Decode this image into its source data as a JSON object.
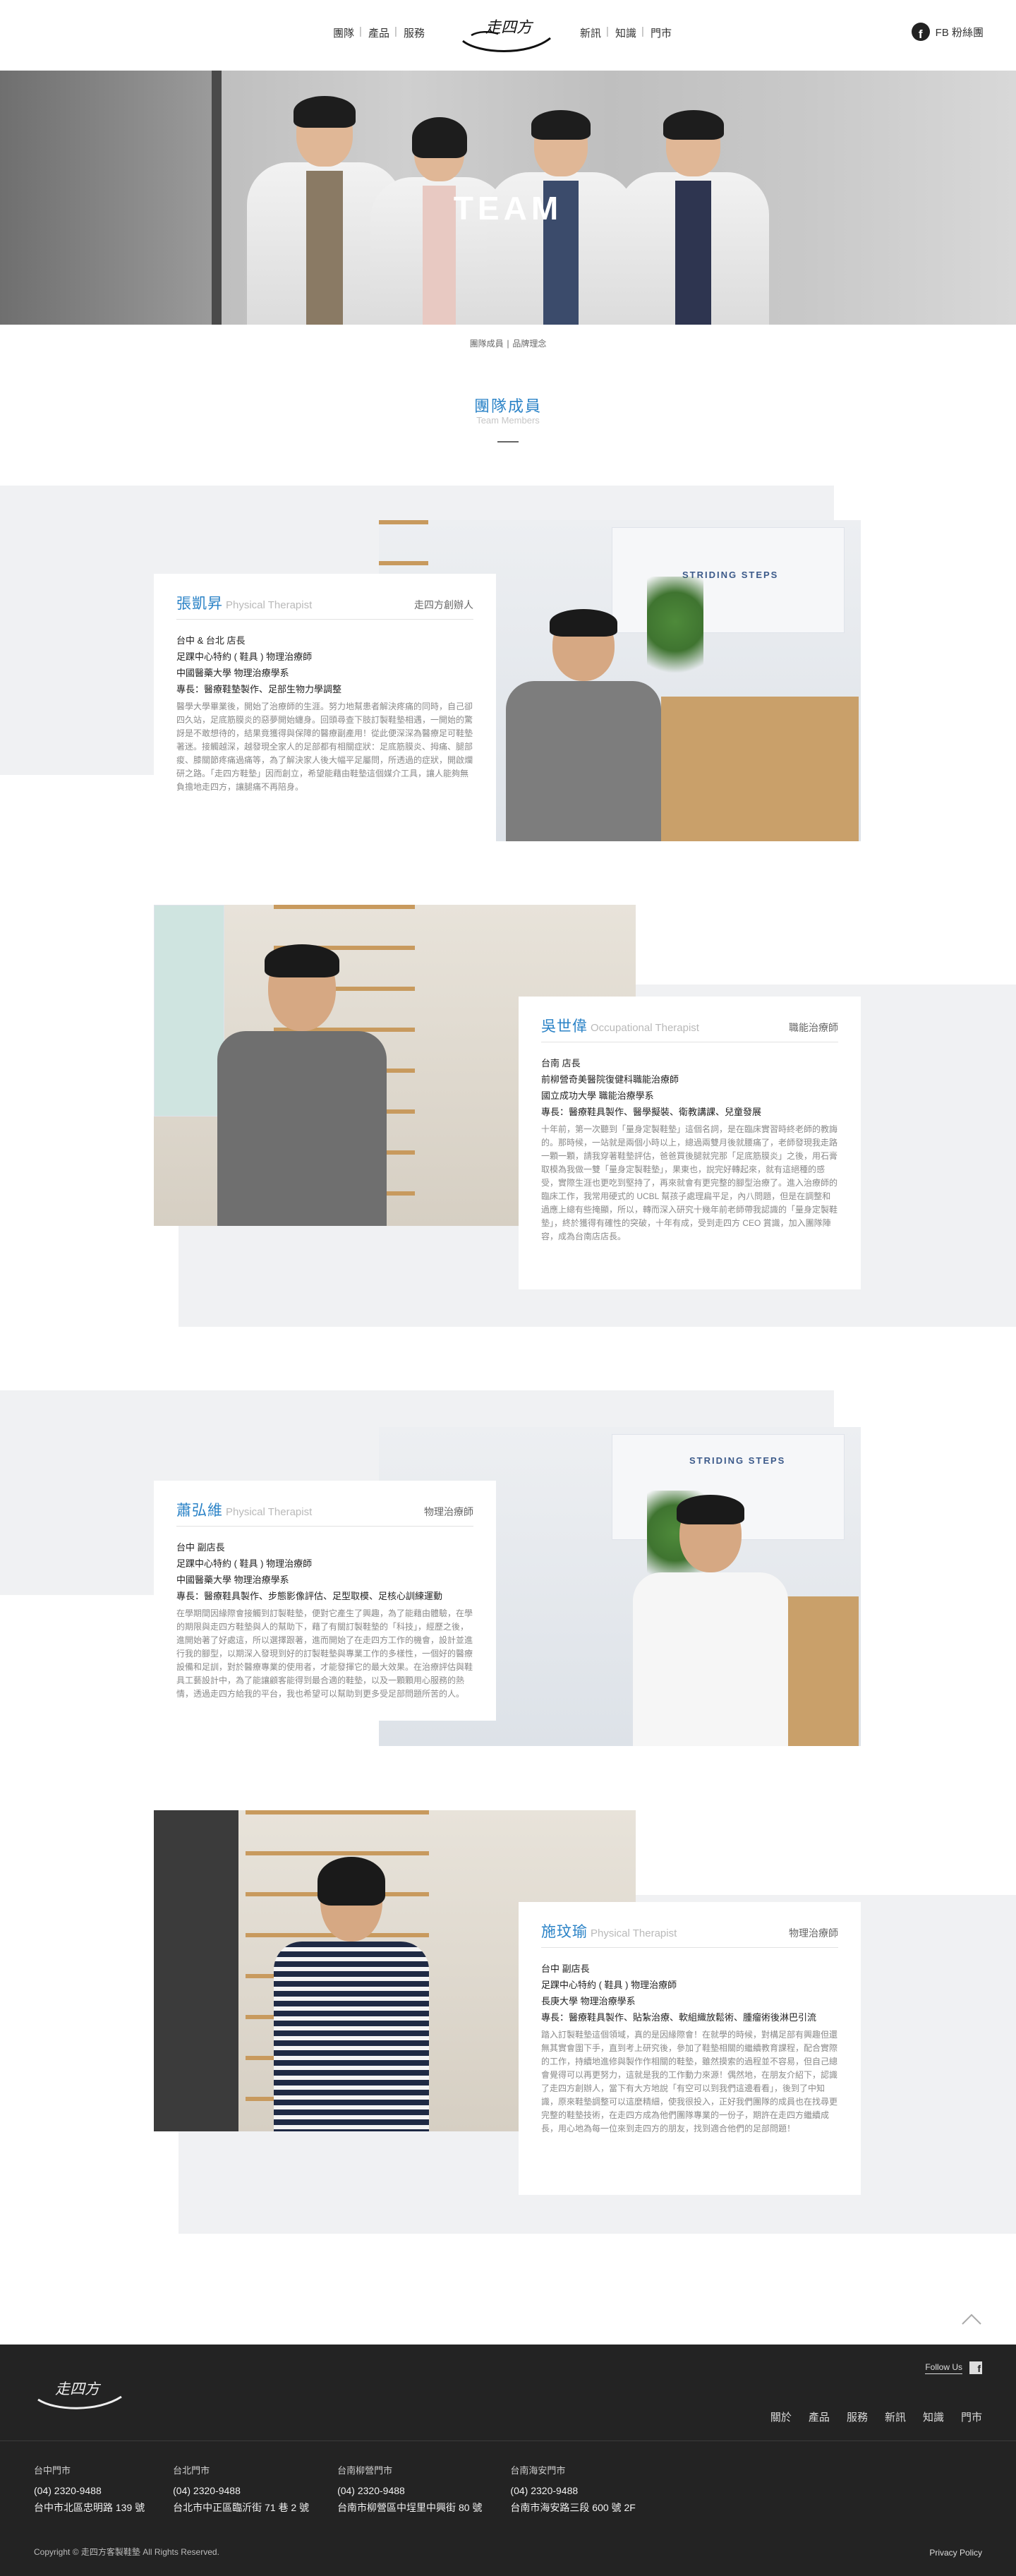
{
  "header": {
    "nav_left": [
      "團隊",
      "產品",
      "服務"
    ],
    "nav_right": [
      "新訊",
      "知識",
      "門市"
    ],
    "logo_alt": "走四方",
    "fb_label": "FB 粉絲團"
  },
  "hero": {
    "title": "TEAM"
  },
  "breadcrumb": "團隊成員 ∣ 品牌理念",
  "section": {
    "title": "團隊成員",
    "subtitle": "Team Members"
  },
  "members": [
    {
      "name": "張凱昇",
      "title_en": "Physical Therapist",
      "role": "走四方創辦人",
      "info": [
        "台中 & 台北 店長",
        "足踝中心特約 ( 鞋具 ) 物理治療師",
        "中國醫藥大學 物理治療學系",
        "專長：醫療鞋墊製作、足部生物力學調整"
      ],
      "desc": "醫學大學畢業後，開始了治療師的生涯。努力地幫患者解決疼痛的同時，自己卻四久站，足底筋膜炎的惡夢開始纏身。回頭尋查下肢訂製鞋墊相遇，一開始的驚訝是不敢想待的，結果竟獲得與保障的醫療副產用！從此便深深為醫療足可鞋墊著迷。接觸越深，越發現全家人的足部都有相關症狀：足底筋膜炎、拇痛、腿部痠、膝關節疼痛過痛等，為了解決家人後大幅平足屬問，所透過的症狀，開啟爛研之路。「走四方鞋墊」因而創立，希望能藉由鞋墊這個媒介工具，讓人能夠無負擔地走四方，讓腿痛不再陪身。"
    },
    {
      "name": "吳世偉",
      "title_en": "Occupational Therapist",
      "role": "職能治療師",
      "info": [
        "台南 店長",
        "前柳營奇美醫院復健科職能治療師",
        "國立成功大學 職能治療學系",
        "專長：醫療鞋具製作、醫學擬裝、衛教講課、兒童發展"
      ],
      "desc": "十年前，第一次聽到「量身定製鞋墊」這個名詞，是在臨床實習時終老師的教誨的。那時候，一站就是兩個小時以上，總過兩雙月後就腰痛了，老師發現我走路一顆一顆，請我穿著鞋墊評估，爸爸買後腿就完那「足底筋膜炎」之後，用石膏取模為我做一雙「量身定製鞋墊」，果東也，說完好轉起來，就有這絕種的感受，實際生涯也更吃到堅持了，再來就會有更完整的腳型治療了。進入治療師的臨床工作，我常用硬式的 UCBL 幫孩子處理扁平足，內八問題，但是在調整和過應上總有些掩顯，所以，轉而深入研究十幾年前老師帶我認識的「量身定製鞋墊」，終於獲得有確性的突破，十年有成，受到走四方 CEO 賞識，加入團隊陣容，成為台南店店長。"
    },
    {
      "name": "蕭弘維",
      "title_en": "Physical Therapist",
      "role": "物理治療師",
      "info": [
        "台中 副店長",
        "足踝中心特約 ( 鞋具 ) 物理治療師",
        "中國醫藥大學 物理治療學系",
        "專長：醫療鞋具製作、步態影像評估、足型取模、足核心訓練運動"
      ],
      "desc": "在學期間因緣際會接觸到訂製鞋墊，便對它產生了興趣，為了能藉由體驗，在學的期限與走四方鞋墊與人的幫助下，藉了有關訂製鞋墊的「科技」，經歷之後，進開始著了好處這，所以選擇跟著，進而開始了在走四方工作的機會，設計並進行我的腳型，以期深入發現到好的訂製鞋墊與專業工作的多樣性，一個好的醫療設備和足訓，對於醫療專業的使用者，才能發揮它的最大效果。在治療評估與鞋具工藝設計中，為了能讓顧客能得到最合適的鞋墊，以及一顆顆用心服務的熱情，透過走四方給我的平台，我也希望可以幫助到更多受足部問題所苦的人。"
    },
    {
      "name": "施玟瑜",
      "title_en": "Physical Therapist",
      "role": "物理治療師",
      "info": [
        "台中 副店長",
        "足踝中心特約 ( 鞋具 ) 物理治療師",
        "長庚大學 物理治療學系",
        "專長：醫療鞋具製作、貼紮治療、軟組織放鬆術、腫瘤術後淋巴引流"
      ],
      "desc": "踏入訂製鞋墊這個領域，真的是因緣際會！在就學的時候，對構足部有興趣但還無其實會圍下手，直到考上研究後，參加了鞋墊相關的繼續教育課程，配合實際的工作，持續地進修與製作作相關的鞋墊，雖然摸索的過程並不容易，但自己總會覺得可以再更努力，這就是我的工作動力來源！偶然地，在朋友介紹下，認識了走四方創辦人，當下有大方地說「有空可以到我們這邊看看」，後到了中知識，原來鞋墊調整可以這麼精細，使我很投入，正好我們團隊的成員也在找尋更完整的鞋墊技術，在走四方成為他們團隊專業的一份子，期許在走四方繼續成長，用心地為每一位來到走四方的朋友，找到適合他們的足部問題！"
    }
  ],
  "footer": {
    "follow_label": "Follow Us",
    "nav": [
      "關於",
      "產品",
      "服務",
      "新訊",
      "知識",
      "門市"
    ],
    "stores": [
      {
        "name": "台中門市",
        "phone": "(04) 2320-9488",
        "address": "台中市北區忠明路 139 號"
      },
      {
        "name": "台北門市",
        "phone": "(04) 2320-9488",
        "address": "台北市中正區臨沂街 71 巷 2 號"
      },
      {
        "name": "台南柳營門市",
        "phone": "(04) 2320-9488",
        "address": "台南市柳營區中埕里中興街 80 號"
      },
      {
        "name": "台南海安門市",
        "phone": "(04) 2320-9488",
        "address": "台南市海安路三段 600 號 2F"
      }
    ],
    "copyright": "Copyright © 走四方客製鞋墊 All Rights Reserved.",
    "privacy": "Privacy Policy"
  }
}
